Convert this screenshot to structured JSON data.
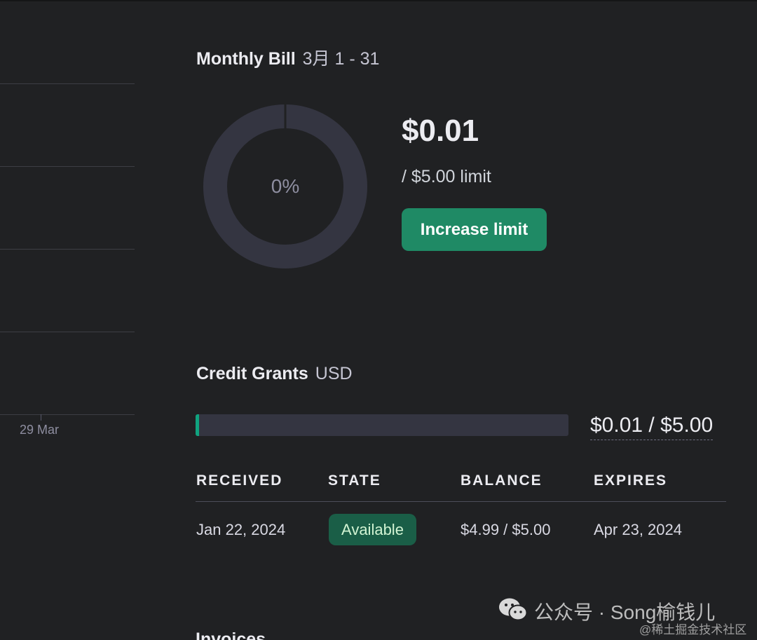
{
  "usage_chart": {
    "x_tick_label": "29 Mar"
  },
  "monthly_bill": {
    "title": "Monthly Bill",
    "period": "3月 1 - 31",
    "percent_label": "0%",
    "usage_fraction": 0.002,
    "amount": "$0.01",
    "limit_text": "/ $5.00 limit",
    "increase_button_label": "Increase limit"
  },
  "credit_grants": {
    "title": "Credit Grants",
    "currency": "USD",
    "used_fraction": 0.002,
    "used_text": "$0.01 / $5.00",
    "columns": [
      "RECEIVED",
      "STATE",
      "BALANCE",
      "EXPIRES"
    ],
    "rows": [
      {
        "received": "Jan 22, 2024",
        "state": "Available",
        "balance": "$4.99 / $5.00",
        "expires": "Apr 23, 2024"
      }
    ]
  },
  "invoices": {
    "title": "Invoices"
  },
  "watermark": {
    "channel": "公众号 · Song榆钱儿",
    "site": "@稀土掘金技术社区"
  },
  "colors": {
    "background": "#202123",
    "accent_green": "#1f8a65",
    "progress_fill": "#10a37f",
    "track": "#343541",
    "badge_bg": "#1a5e47"
  }
}
